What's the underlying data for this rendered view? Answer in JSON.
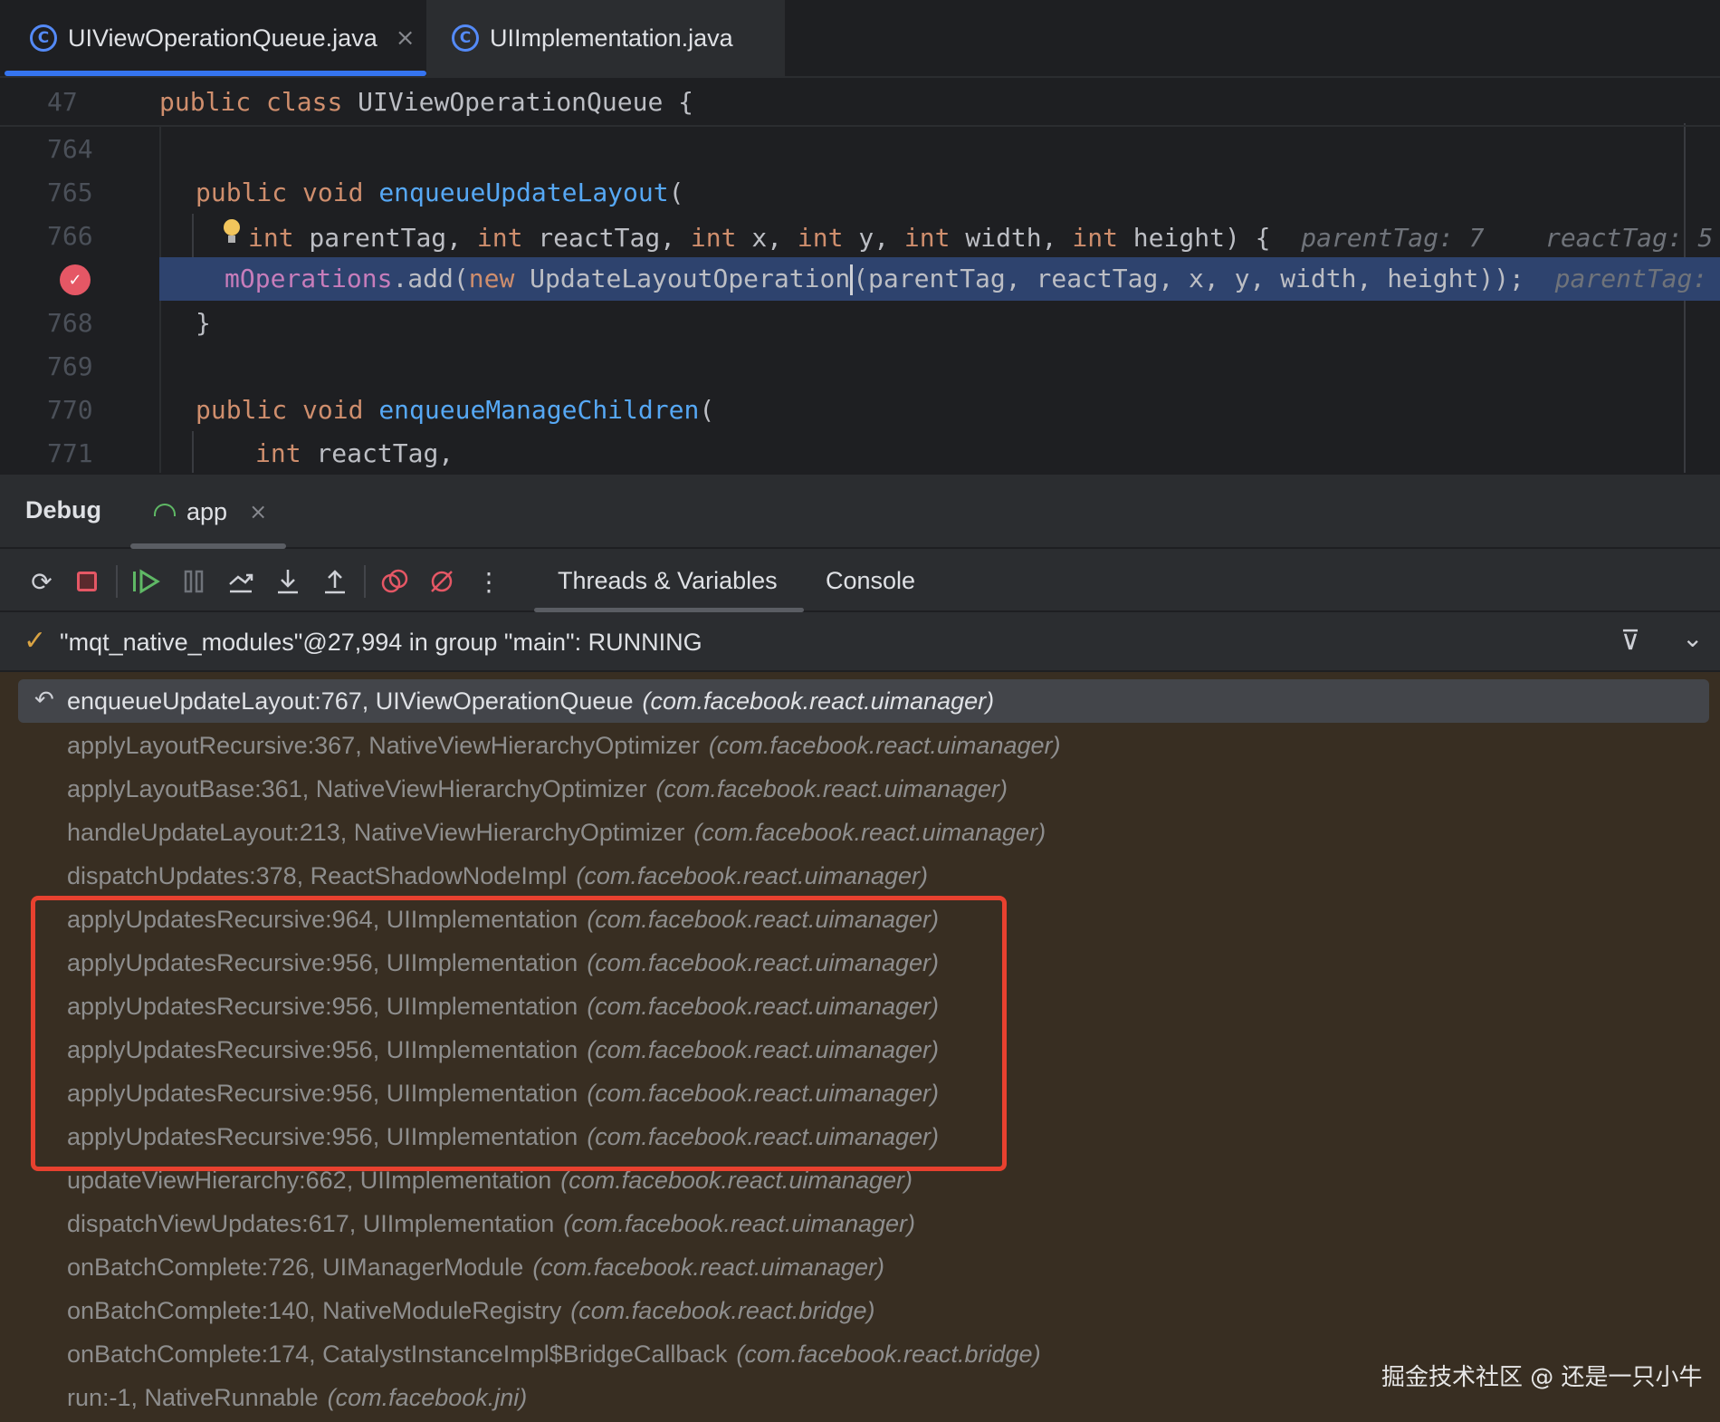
{
  "tabs": [
    {
      "label": "UIViewOperationQueue.java",
      "icon": "class-icon",
      "active": true
    },
    {
      "label": "UIImplementation.java",
      "icon": "class-icon",
      "active": false
    }
  ],
  "editor": {
    "sticky_line_number": "47",
    "sticky_code": {
      "kw1": "public",
      "kw2": "class",
      "name": "UIViewOperationQueue {"
    },
    "line_numbers": [
      "764",
      "765",
      "766",
      "768",
      "769",
      "770",
      "771"
    ],
    "line765": {
      "kw1": "public",
      "kw2": "void",
      "fn": "enqueueUpdateLayout",
      "rest": "("
    },
    "line766": {
      "int": "int",
      "p1": " parentTag, ",
      "p2": " reactTag, ",
      "p3": " x, ",
      "p4": " y, ",
      "p5": " width, ",
      "p6": " height) {",
      "hint1": "parentTag: 7",
      "hint2": "reactTag: 5"
    },
    "line767": {
      "field": "mOperations",
      "call": ".add(",
      "kw": "new",
      "cls": " UpdateLayoutOperation",
      "args": "(parentTag, reactTag, x, y, width, height));",
      "hint": "parentTag:"
    },
    "line768": "}",
    "line770": {
      "kw1": "public",
      "kw2": "void",
      "fn": "enqueueManageChildren",
      "rest": "("
    },
    "line771": {
      "int": "int",
      "rest": " reactTag,"
    }
  },
  "debug": {
    "title": "Debug",
    "session_tab": "app",
    "tabs": [
      "Threads & Variables",
      "Console"
    ],
    "thread_status": "\"mqt_native_modules\"@27,994 in group \"main\": RUNNING",
    "frames": [
      {
        "method": "enqueueUpdateLayout:767, UIViewOperationQueue",
        "pkg": "(com.facebook.react.uimanager)"
      },
      {
        "method": "applyLayoutRecursive:367, NativeViewHierarchyOptimizer",
        "pkg": "(com.facebook.react.uimanager)"
      },
      {
        "method": "applyLayoutBase:361, NativeViewHierarchyOptimizer",
        "pkg": "(com.facebook.react.uimanager)"
      },
      {
        "method": "handleUpdateLayout:213, NativeViewHierarchyOptimizer",
        "pkg": "(com.facebook.react.uimanager)"
      },
      {
        "method": "dispatchUpdates:378, ReactShadowNodeImpl",
        "pkg": "(com.facebook.react.uimanager)"
      },
      {
        "method": "applyUpdatesRecursive:964, UIImplementation",
        "pkg": "(com.facebook.react.uimanager)"
      },
      {
        "method": "applyUpdatesRecursive:956, UIImplementation",
        "pkg": "(com.facebook.react.uimanager)"
      },
      {
        "method": "applyUpdatesRecursive:956, UIImplementation",
        "pkg": "(com.facebook.react.uimanager)"
      },
      {
        "method": "applyUpdatesRecursive:956, UIImplementation",
        "pkg": "(com.facebook.react.uimanager)"
      },
      {
        "method": "applyUpdatesRecursive:956, UIImplementation",
        "pkg": "(com.facebook.react.uimanager)"
      },
      {
        "method": "applyUpdatesRecursive:956, UIImplementation",
        "pkg": "(com.facebook.react.uimanager)"
      },
      {
        "method": "updateViewHierarchy:662, UIImplementation",
        "pkg": "(com.facebook.react.uimanager)"
      },
      {
        "method": "dispatchViewUpdates:617, UIImplementation",
        "pkg": "(com.facebook.react.uimanager)"
      },
      {
        "method": "onBatchComplete:726, UIManagerModule",
        "pkg": "(com.facebook.react.uimanager)"
      },
      {
        "method": "onBatchComplete:140, NativeModuleRegistry",
        "pkg": "(com.facebook.react.bridge)"
      },
      {
        "method": "onBatchComplete:174, CatalystInstanceImpl$BridgeCallback",
        "pkg": "(com.facebook.react.bridge)"
      },
      {
        "method": "run:-1, NativeRunnable",
        "pkg": "(com.facebook.jni)"
      }
    ]
  },
  "watermark": "掘金技术社区 @ 还是一只小牛",
  "colors": {
    "accent": "#3574f0",
    "highlight_line": "#2e436e",
    "frames_bg": "#382e22",
    "annotation_box": "#e8412f"
  }
}
